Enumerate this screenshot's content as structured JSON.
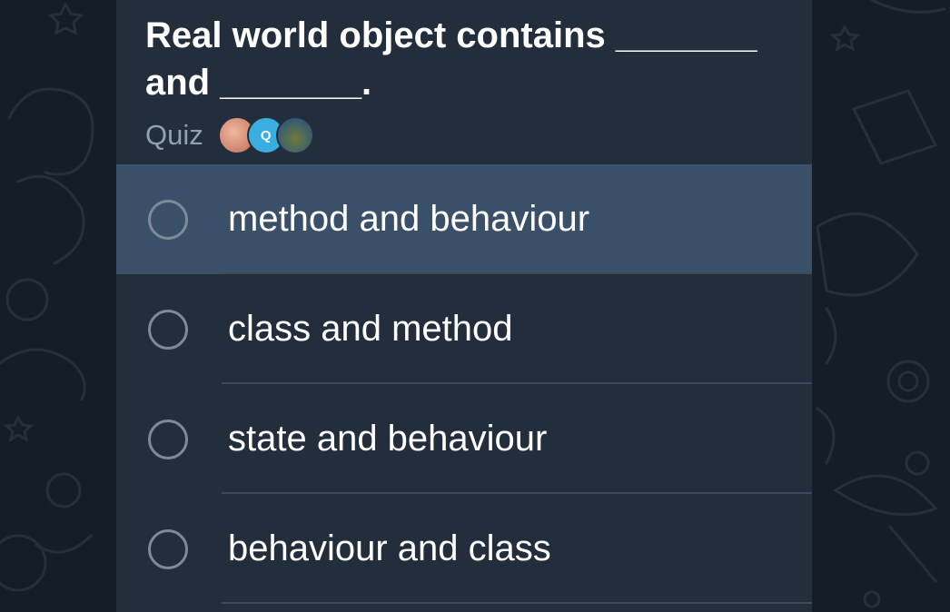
{
  "poll": {
    "question": "Real world object contains _______\nand _______.",
    "type_label": "Quiz",
    "recent_voters": [
      {
        "avatar": "photo-avatar"
      },
      {
        "avatar": "letter-avatar",
        "initial": "Q"
      },
      {
        "avatar": "cartoon-avatar"
      }
    ],
    "options": [
      {
        "text": "method and behaviour",
        "highlighted": true
      },
      {
        "text": "class and method",
        "highlighted": false
      },
      {
        "text": "state and behaviour",
        "highlighted": false
      },
      {
        "text": "behaviour and class",
        "highlighted": false
      }
    ]
  },
  "colors": {
    "chat_background": "#151e27",
    "bubble": "#232e3c",
    "highlight": "#3a5068",
    "radio_ring": "#7d8b99",
    "secondary_text": "#8fa1b3"
  }
}
